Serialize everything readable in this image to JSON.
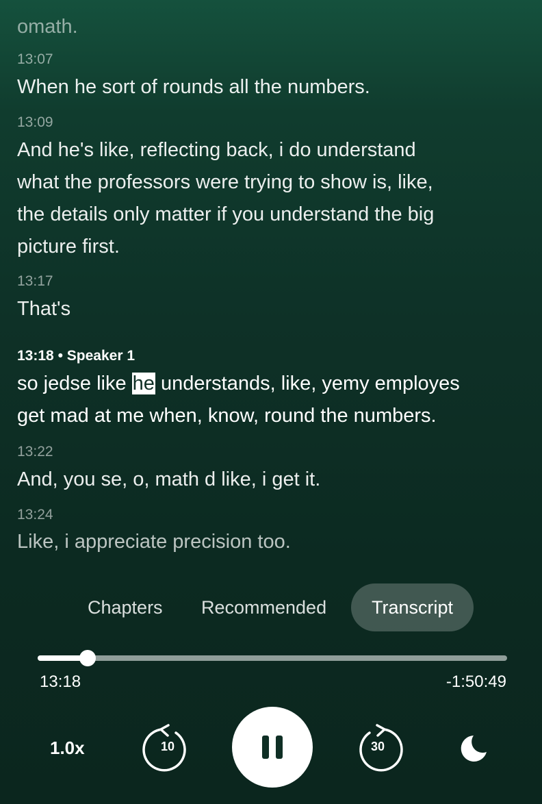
{
  "transcript": {
    "faded_top_text": "omath.",
    "segments": [
      {
        "time": "13:07",
        "lines": [
          "When he sort of rounds all the numbers."
        ]
      },
      {
        "time": "13:09",
        "lines": [
          "And he's like, reflecting back, i do understand",
          "what the professors were trying to show is, like,",
          "the details only matter if you understand the big",
          "picture first."
        ]
      },
      {
        "time": "13:17",
        "lines": [
          "That's"
        ]
      },
      {
        "time": "13:18",
        "speaker": "Speaker 1",
        "separator": "•",
        "line1_before": "so jedse like ",
        "highlighted_word": "he",
        "line1_after": " understands, like, yemy employes",
        "line2": "get mad at me when, know, round the numbers."
      },
      {
        "time": "13:22",
        "lines": [
          "And, you se, o, math d like, i get it."
        ]
      },
      {
        "time": "13:24",
        "lines": [
          "Like, i appreciate precision too."
        ]
      }
    ]
  },
  "tabs": [
    {
      "label": "Chapters",
      "active": false
    },
    {
      "label": "Recommended",
      "active": false
    },
    {
      "label": "Transcript",
      "active": true
    }
  ],
  "player": {
    "elapsed": "13:18",
    "remaining": "-1:50:49",
    "progress_fraction": 0.107,
    "speed": "1.0x",
    "skip_back_seconds": "10",
    "skip_forward_seconds": "30",
    "state": "playing",
    "icons": {
      "skip_back": "rewind-10-icon",
      "play_pause": "pause-icon",
      "skip_forward": "forward-30-icon",
      "sleep_timer": "moon-icon"
    }
  },
  "colors": {
    "background_top": "#15513d",
    "background_bottom": "#0b261e",
    "active_tab_bg": "rgba(255,255,255,0.22)",
    "highlight_bg": "#ffffff"
  }
}
